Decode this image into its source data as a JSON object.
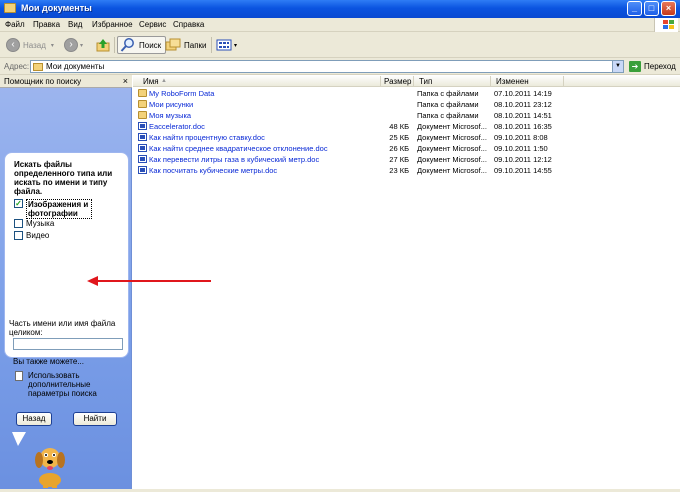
{
  "window": {
    "title": "Мои документы"
  },
  "menu": [
    "Файл",
    "Правка",
    "Вид",
    "Избранное",
    "Сервис",
    "Справка"
  ],
  "toolbar": {
    "back": "Назад",
    "search": "Поиск",
    "folders": "Папки"
  },
  "address": {
    "label": "Адрес:",
    "value": "Мои документы",
    "go": "Переход"
  },
  "left_pane": {
    "header": "Помощник по поиску",
    "prompt": "Искать файлы определенного типа или искать по имени и типу файла.",
    "options": [
      {
        "label": "Изображения и фотографии",
        "checked": true
      },
      {
        "label": "Музыка",
        "checked": false
      },
      {
        "label": "Видео",
        "checked": false
      }
    ],
    "name_field_label": "Часть имени или имя файла целиком:",
    "name_field_value": "",
    "also": "Вы также можете...",
    "advanced": "Использовать дополнительные параметры поиска",
    "back_button": "Назад",
    "find_button": "Найти"
  },
  "file_list": {
    "columns": [
      "Имя",
      "Размер",
      "Тип",
      "Изменен"
    ],
    "rows": [
      {
        "icon": "folder",
        "name": "My RoboForm Data",
        "size": "",
        "type": "Папка с файлами",
        "modified": "07.10.2011 14:19"
      },
      {
        "icon": "folder",
        "name": "Мои рисунки",
        "size": "",
        "type": "Папка с файлами",
        "modified": "08.10.2011 23:12"
      },
      {
        "icon": "folder",
        "name": "Моя музыка",
        "size": "",
        "type": "Папка с файлами",
        "modified": "08.10.2011 14:51"
      },
      {
        "icon": "doc",
        "name": "Eaccelerator.doc",
        "size": "48 КБ",
        "type": "Документ Microsof...",
        "modified": "08.10.2011 16:35"
      },
      {
        "icon": "doc",
        "name": "Как найти процентную ставку.doc",
        "size": "25 КБ",
        "type": "Документ Microsof...",
        "modified": "09.10.2011 8:08"
      },
      {
        "icon": "doc",
        "name": "Как найти среднее квадратическое отклонение.doc",
        "size": "26 КБ",
        "type": "Документ Microsof...",
        "modified": "09.10.2011 1:50"
      },
      {
        "icon": "doc",
        "name": "Как перевести литры газа в кубический метр.doc",
        "size": "27 КБ",
        "type": "Документ Microsof...",
        "modified": "09.10.2011 12:12"
      },
      {
        "icon": "doc",
        "name": "Как посчитать кубические метры.doc",
        "size": "23 КБ",
        "type": "Документ Microsof...",
        "modified": "09.10.2011 14:55"
      }
    ]
  },
  "colors": {
    "title_bar": "#0b54e0",
    "panel": "#7a9ee8",
    "annotation_arrow": "#e0161c",
    "link": "#0a2ad6"
  }
}
